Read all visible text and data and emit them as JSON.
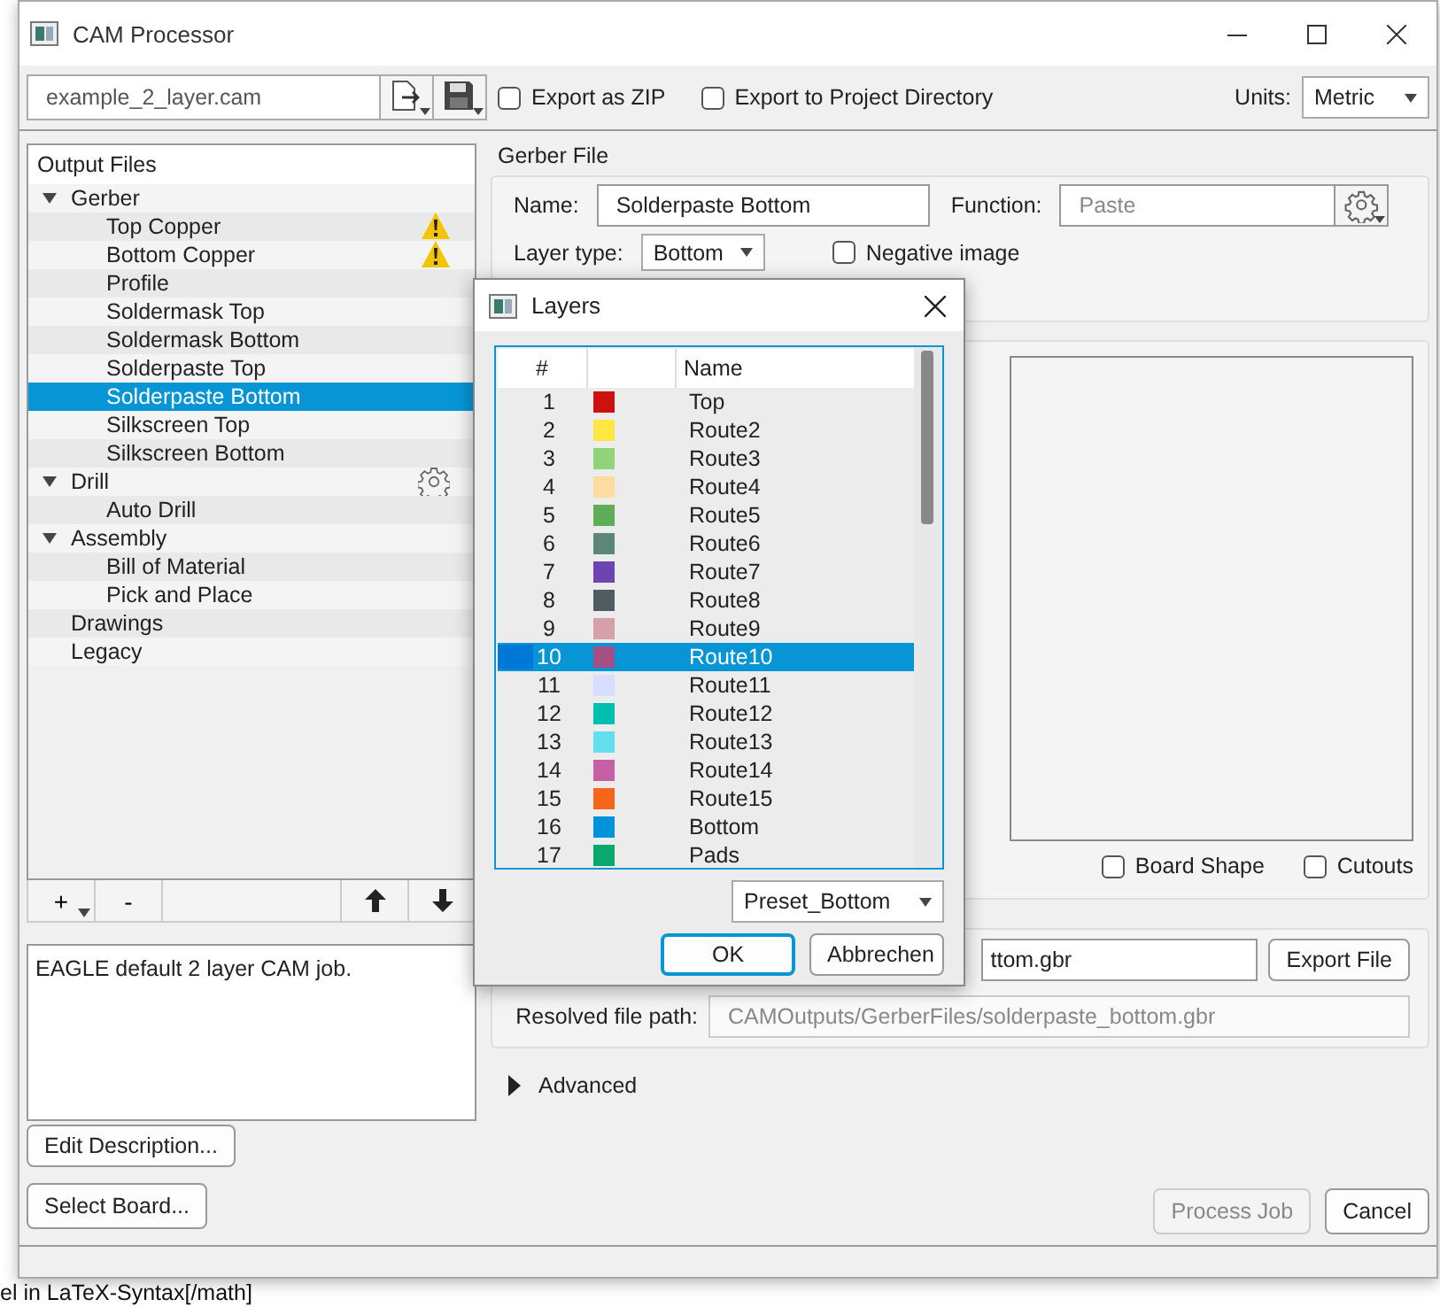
{
  "window": {
    "title": "CAM Processor"
  },
  "toolbar": {
    "job_file": "example_2_layer.cam",
    "export_zip": {
      "label": "Export as ZIP",
      "checked": false
    },
    "export_project_dir": {
      "label": "Export to Project Directory",
      "checked": false
    },
    "units_label": "Units:",
    "units": "Metric"
  },
  "output_files": {
    "header": "Output Files",
    "items": [
      {
        "label": "Gerber",
        "expanded": true,
        "selected": false,
        "warning": false,
        "settings": false,
        "children": [
          {
            "label": "Top Copper",
            "selected": false,
            "warning": true,
            "settings": false
          },
          {
            "label": "Bottom Copper",
            "selected": false,
            "warning": true,
            "settings": false
          },
          {
            "label": "Profile",
            "selected": false,
            "warning": false,
            "settings": false
          },
          {
            "label": "Soldermask Top",
            "selected": false,
            "warning": false,
            "settings": false
          },
          {
            "label": "Soldermask Bottom",
            "selected": false,
            "warning": false,
            "settings": false
          },
          {
            "label": "Solderpaste Top",
            "selected": false,
            "warning": false,
            "settings": false
          },
          {
            "label": "Solderpaste Bottom",
            "selected": true,
            "warning": false,
            "settings": false
          },
          {
            "label": "Silkscreen Top",
            "selected": false,
            "warning": false,
            "settings": false
          },
          {
            "label": "Silkscreen Bottom",
            "selected": false,
            "warning": false,
            "settings": false
          }
        ]
      },
      {
        "label": "Drill",
        "expanded": true,
        "selected": false,
        "warning": false,
        "settings": true,
        "children": [
          {
            "label": "Auto Drill",
            "selected": false,
            "warning": false,
            "settings": false
          }
        ]
      },
      {
        "label": "Assembly",
        "expanded": true,
        "selected": false,
        "warning": false,
        "settings": false,
        "children": [
          {
            "label": "Bill of Material",
            "selected": false,
            "warning": false,
            "settings": false
          },
          {
            "label": "Pick and Place",
            "selected": false,
            "warning": false,
            "settings": false
          }
        ]
      },
      {
        "label": "Drawings",
        "selected": false,
        "warning": false,
        "settings": false
      },
      {
        "label": "Legacy",
        "selected": false,
        "warning": false,
        "settings": false
      }
    ]
  },
  "list_buttons": [
    "+",
    "-"
  ],
  "description": "EAGLE default 2 layer CAM job.",
  "edit_description": "Edit Description...",
  "select_board": "Select Board...",
  "gerber_file": {
    "title": "Gerber File",
    "name_label": "Name:",
    "name": "Solderpaste Bottom",
    "function_label": "Function:",
    "function": "Paste",
    "layer_type_label": "Layer type:",
    "layer_type": "Bottom",
    "negative_image": {
      "label": "Negative image",
      "checked": false
    }
  },
  "preview": {
    "board_shape": {
      "label": "Board Shape",
      "checked": false
    },
    "cutouts": {
      "label": "Cutouts",
      "checked": false
    }
  },
  "output": {
    "file_name": "ttom.gbr",
    "export_button": "Export File",
    "resolved_label": "Resolved file path:",
    "resolved_path": "CAMOutputs/GerberFiles/solderpaste_bottom.gbr"
  },
  "advanced": {
    "label": "Advanced",
    "expanded": false
  },
  "buttons": {
    "process_job": {
      "label": "Process Job",
      "disabled": true
    },
    "cancel": "Cancel"
  },
  "layers_dialog": {
    "title": "Layers",
    "columns": [
      "#",
      "Name"
    ],
    "rows": [
      {
        "number": "1",
        "color": "#cc1111",
        "name": "Top",
        "selected": false
      },
      {
        "number": "2",
        "color": "#ffe640",
        "name": "Route2",
        "selected": false
      },
      {
        "number": "3",
        "color": "#92d27a",
        "name": "Route3",
        "selected": false
      },
      {
        "number": "4",
        "color": "#ffdba0",
        "name": "Route4",
        "selected": false
      },
      {
        "number": "5",
        "color": "#5fad56",
        "name": "Route5",
        "selected": false
      },
      {
        "number": "6",
        "color": "#5e8677",
        "name": "Route6",
        "selected": false
      },
      {
        "number": "7",
        "color": "#6e44b0",
        "name": "Route7",
        "selected": false
      },
      {
        "number": "8",
        "color": "#505d60",
        "name": "Route8",
        "selected": false
      },
      {
        "number": "9",
        "color": "#d6a0aa",
        "name": "Route9",
        "selected": false
      },
      {
        "number": "10",
        "color": "#a64f86",
        "name": "Route10",
        "selected": true
      },
      {
        "number": "11",
        "color": "#d8deff",
        "name": "Route11",
        "selected": false
      },
      {
        "number": "12",
        "color": "#00bfae",
        "name": "Route12",
        "selected": false
      },
      {
        "number": "13",
        "color": "#64dfef",
        "name": "Route13",
        "selected": false
      },
      {
        "number": "14",
        "color": "#c65fa3",
        "name": "Route14",
        "selected": false
      },
      {
        "number": "15",
        "color": "#f5651a",
        "name": "Route15",
        "selected": false
      },
      {
        "number": "16",
        "color": "#0093d9",
        "name": "Bottom",
        "selected": false
      },
      {
        "number": "17",
        "color": "#0aa86e",
        "name": "Pads",
        "selected": false
      }
    ],
    "preset": "Preset_Bottom",
    "ok": "OK",
    "cancel": "Abbrechen"
  },
  "background_text": "el in LaTeX-Syntax[/math]"
}
